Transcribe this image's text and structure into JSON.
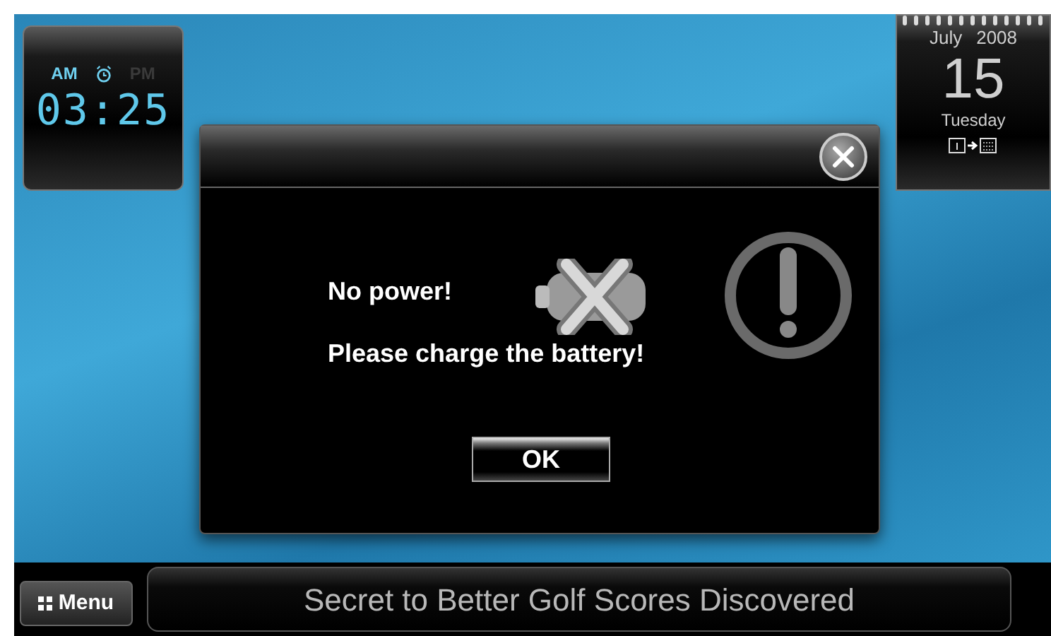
{
  "clock": {
    "periods": [
      {
        "label": "AM",
        "selected": true
      },
      {
        "label": "PM",
        "selected": false
      }
    ],
    "time": "03:25"
  },
  "calendar": {
    "month": "July",
    "year": "2008",
    "day": "15",
    "weekday": "Tuesday"
  },
  "dialog": {
    "lines": [
      "No power!",
      "Please charge the battery!"
    ],
    "ok_button": "OK"
  },
  "bottom_bar": {
    "menu_button": "Menu",
    "ticker": "Secret to Better Golf Scores Discovered"
  }
}
